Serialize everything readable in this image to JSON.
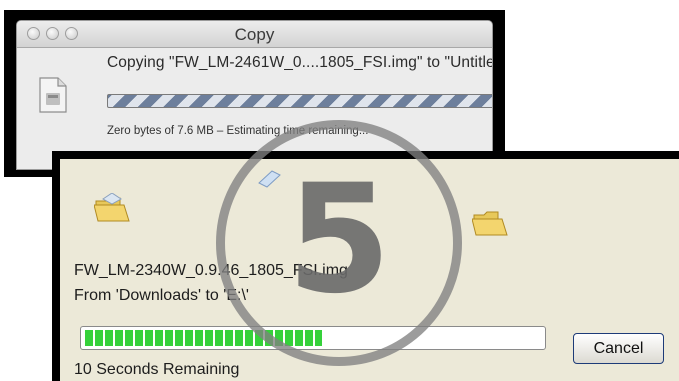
{
  "mac_dialog": {
    "title": "Copy",
    "message": "Copying \"FW_LM-2461W_0....1805_FSI.img\" to \"Untitled\"",
    "status": "Zero bytes of 7.6 MB – Estimating time remaining...",
    "icons": [
      "close-icon",
      "minimize-icon",
      "zoom-icon",
      "document-icon",
      "stop-icon"
    ]
  },
  "win_dialog": {
    "file_name": "FW_LM-2340W_0.9.46_1805_FSI.img",
    "from_to": "From 'Downloads' to 'E:\\'",
    "progress": 0.52,
    "progress_color": "#35d13a",
    "remaining": "10 Seconds Remaining",
    "cancel_label": "Cancel",
    "icons": [
      "folder-open-icon",
      "paper-icon",
      "folder-open-icon"
    ]
  },
  "step_badge": {
    "number": "5"
  }
}
